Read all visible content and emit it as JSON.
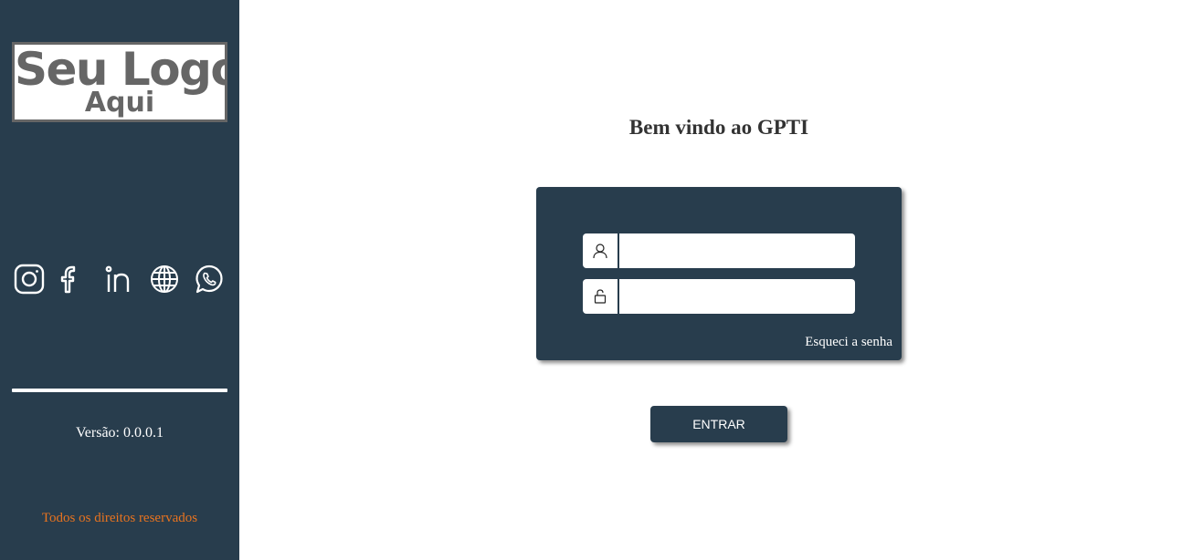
{
  "sidebar": {
    "logo": {
      "line1": "Seu Logo",
      "line2": "Aqui"
    },
    "social_icons": [
      "instagram-icon",
      "facebook-icon",
      "linkedin-icon",
      "globe-icon",
      "whatsapp-icon"
    ],
    "version": "Versão: 0.0.0.1",
    "rights": "Todos os direitos reservados"
  },
  "main": {
    "welcome": "Bem vindo ao GPTI",
    "login": {
      "username_value": "",
      "password_value": "",
      "username_icon": "user-icon",
      "password_icon": "lock-icon",
      "forgot_label": "Esqueci a senha",
      "submit_label": "ENTRAR"
    }
  },
  "colors": {
    "sidebar_bg": "#283d4d",
    "accent_orange": "#e8731f",
    "text_dark": "#333333"
  }
}
